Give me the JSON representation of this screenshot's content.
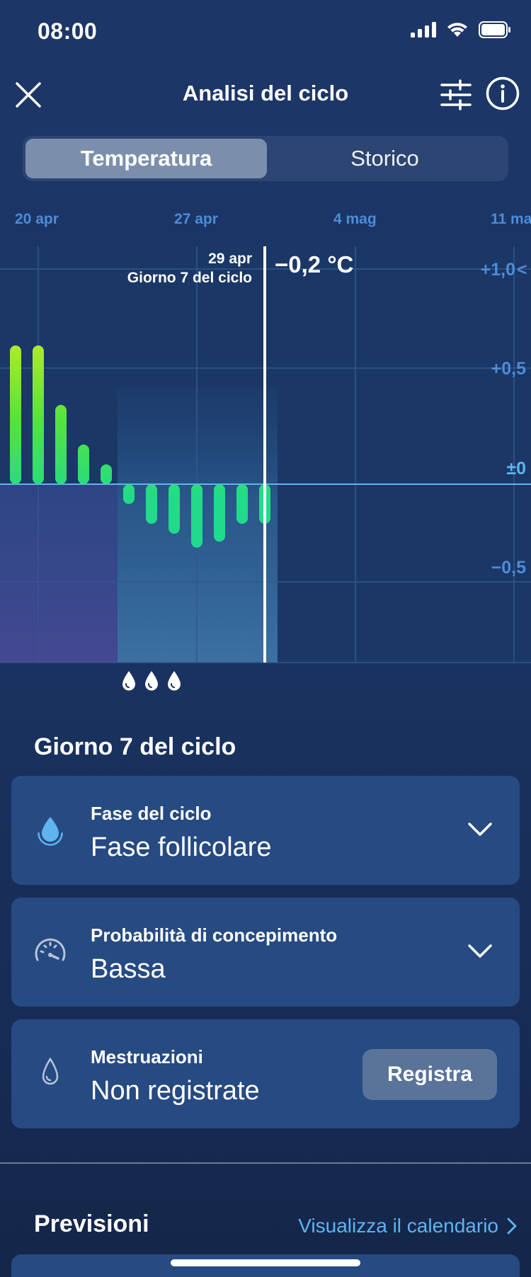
{
  "status_bar": {
    "time": "08:00"
  },
  "header": {
    "title": "Analisi del ciclo"
  },
  "tabs": [
    {
      "label": "Temperatura",
      "active": true
    },
    {
      "label": "Storico",
      "active": false
    }
  ],
  "chart_data": {
    "type": "bar",
    "x_labels": [
      "20 apr",
      "27 apr",
      "4 mag",
      "11 mag"
    ],
    "y_ticks": [
      "+1,0",
      "+0,5",
      "±0",
      "−0,5"
    ],
    "ylim": [
      -0.9,
      1.15
    ],
    "unit": "°C",
    "values": [
      0.7,
      0.7,
      0.4,
      0.2,
      0.1,
      -0.1,
      -0.2,
      -0.25,
      -0.32,
      -0.29,
      -0.2,
      -0.2
    ],
    "selected": {
      "date": "29 apr",
      "cycle_day": "Giorno 7 del ciclo",
      "value": "−0,2 °C"
    },
    "colors": {
      "bar_high": "#c8ef2d",
      "bar_low": "#1edd8c",
      "zero_line": "#5fb4f0",
      "menstruation_zone": "#3d4a8c",
      "fertile_zone": "#3a6f9f"
    }
  },
  "day_section": {
    "title": "Giorno 7 del ciclo"
  },
  "cards": [
    {
      "label": "Fase del ciclo",
      "value": "Fase follicolare",
      "icon": "drop-filled-icon"
    },
    {
      "label": "Probabilità di concepimento",
      "value": "Bassa",
      "icon": "gauge-icon"
    },
    {
      "label": "Mestruazioni",
      "value": "Non registrate",
      "icon": "drop-outline-icon",
      "button": "Registra"
    }
  ],
  "forecast": {
    "title": "Previsioni",
    "link": "Visualizza il calendario"
  }
}
